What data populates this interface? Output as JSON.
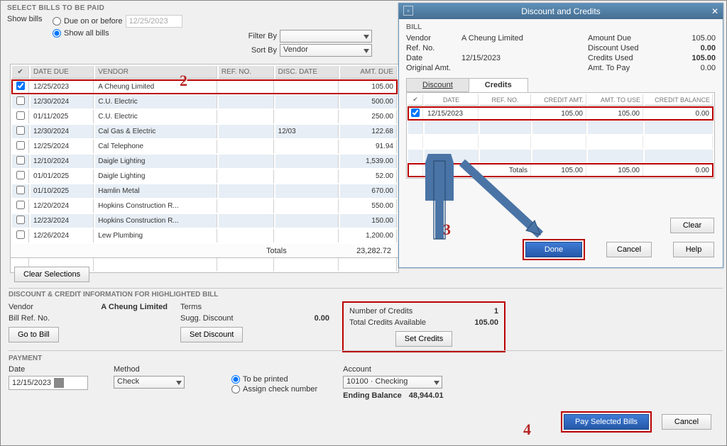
{
  "sectionTitle": "SELECT BILLS TO BE PAID",
  "showBillsLabel": "Show bills",
  "dueOnOrBeforeLabel": "Due on or before",
  "dueOnOrBeforeDate": "12/25/2023",
  "showAllBillsLabel": "Show all bills",
  "filterByLabel": "Filter By",
  "filterByValue": "",
  "sortByLabel": "Sort By",
  "sortByValue": "Vendor",
  "billsColumns": {
    "date": "DATE DUE",
    "vendor": "VENDOR",
    "ref": "REF. NO.",
    "disc": "DISC. DATE",
    "amt": "AMT. DUE"
  },
  "bills": [
    {
      "checked": true,
      "date": "12/25/2023",
      "vendor": "A Cheung Limited",
      "ref": "",
      "disc": "",
      "amt": "105.00"
    },
    {
      "checked": false,
      "date": "12/30/2024",
      "vendor": "C.U. Electric",
      "ref": "",
      "disc": "",
      "amt": "500.00"
    },
    {
      "checked": false,
      "date": "01/11/2025",
      "vendor": "C.U. Electric",
      "ref": "",
      "disc": "",
      "amt": "250.00"
    },
    {
      "checked": false,
      "date": "12/30/2024",
      "vendor": "Cal Gas & Electric",
      "ref": "",
      "disc": "12/03",
      "amt": "122.68"
    },
    {
      "checked": false,
      "date": "12/25/2024",
      "vendor": "Cal Telephone",
      "ref": "",
      "disc": "",
      "amt": "91.94"
    },
    {
      "checked": false,
      "date": "12/10/2024",
      "vendor": "Daigle Lighting",
      "ref": "",
      "disc": "",
      "amt": "1,539.00"
    },
    {
      "checked": false,
      "date": "01/01/2025",
      "vendor": "Daigle Lighting",
      "ref": "",
      "disc": "",
      "amt": "52.00"
    },
    {
      "checked": false,
      "date": "01/10/2025",
      "vendor": "Hamlin Metal",
      "ref": "",
      "disc": "",
      "amt": "670.00"
    },
    {
      "checked": false,
      "date": "12/20/2024",
      "vendor": "Hopkins Construction R...",
      "ref": "",
      "disc": "",
      "amt": "550.00"
    },
    {
      "checked": false,
      "date": "12/23/2024",
      "vendor": "Hopkins Construction R...",
      "ref": "",
      "disc": "",
      "amt": "150.00"
    },
    {
      "checked": false,
      "date": "12/26/2024",
      "vendor": "Lew Plumbing",
      "ref": "",
      "disc": "",
      "amt": "1,200.00"
    }
  ],
  "totalsLabel": "Totals",
  "totalsValue": "23,282.72",
  "clearSelectionsLabel": "Clear Selections",
  "dcTitle": "DISCOUNT & CREDIT INFORMATION FOR HIGHLIGHTED BILL",
  "dc": {
    "vendorLabel": "Vendor",
    "vendorValue": "A Cheung Limited",
    "billRefLabel": "Bill Ref. No.",
    "goToBillLabel": "Go to Bill",
    "termsLabel": "Terms",
    "suggDiscountLabel": "Sugg. Discount",
    "suggDiscountValue": "0.00",
    "setDiscountLabel": "Set Discount",
    "numCreditsLabel": "Number of Credits",
    "numCreditsValue": "1",
    "totalCreditsLabel": "Total Credits Available",
    "totalCreditsValue": "105.00",
    "setCreditsLabel": "Set Credits"
  },
  "paymentTitle": "PAYMENT",
  "pay": {
    "dateLabel": "Date",
    "dateValue": "12/15/2023",
    "methodLabel": "Method",
    "methodValue": "Check",
    "toBePrintedLabel": "To be printed",
    "assignCheckLabel": "Assign check number",
    "accountLabel": "Account",
    "accountValue": "10100 · Checking",
    "endingBalanceLabel": "Ending Balance",
    "endingBalanceValue": "48,944.01"
  },
  "paySelectedBillsLabel": "Pay Selected Bills",
  "cancelLabel": "Cancel",
  "dialog": {
    "title": "Discount and Credits",
    "billHeader": "BILL",
    "left": {
      "vendorLabel": "Vendor",
      "vendorValue": "A Cheung Limited",
      "refLabel": "Ref. No.",
      "refValue": "",
      "dateLabel": "Date",
      "dateValue": "12/15/2023",
      "origAmtLabel": "Original Amt.",
      "origAmtValue": ""
    },
    "right": {
      "amountDueLabel": "Amount Due",
      "amountDueValue": "105.00",
      "discountUsedLabel": "Discount Used",
      "discountUsedValue": "0.00",
      "creditsUsedLabel": "Credits Used",
      "creditsUsedValue": "105.00",
      "amtToPayLabel": "Amt. To Pay",
      "amtToPayValue": "0.00"
    },
    "tabDiscount": "Discount",
    "tabCredits": "Credits",
    "creditsColumns": {
      "date": "DATE",
      "ref": "REF. NO.",
      "credit": "CREDIT AMT.",
      "amtuse": "AMT. TO USE",
      "bal": "CREDIT BALANCE"
    },
    "creditsRows": [
      {
        "checked": true,
        "date": "12/15/2023",
        "ref": "",
        "credit": "105.00",
        "amtuse": "105.00",
        "bal": "0.00"
      }
    ],
    "creditsTotalsLabel": "Totals",
    "creditsTotal": {
      "credit": "105.00",
      "amtuse": "105.00",
      "bal": "0.00"
    },
    "clearLabel": "Clear",
    "doneLabel": "Done",
    "cancelLabel": "Cancel",
    "helpLabel": "Help"
  },
  "annotations": {
    "n2": "2",
    "n3": "3",
    "n4": "4"
  }
}
